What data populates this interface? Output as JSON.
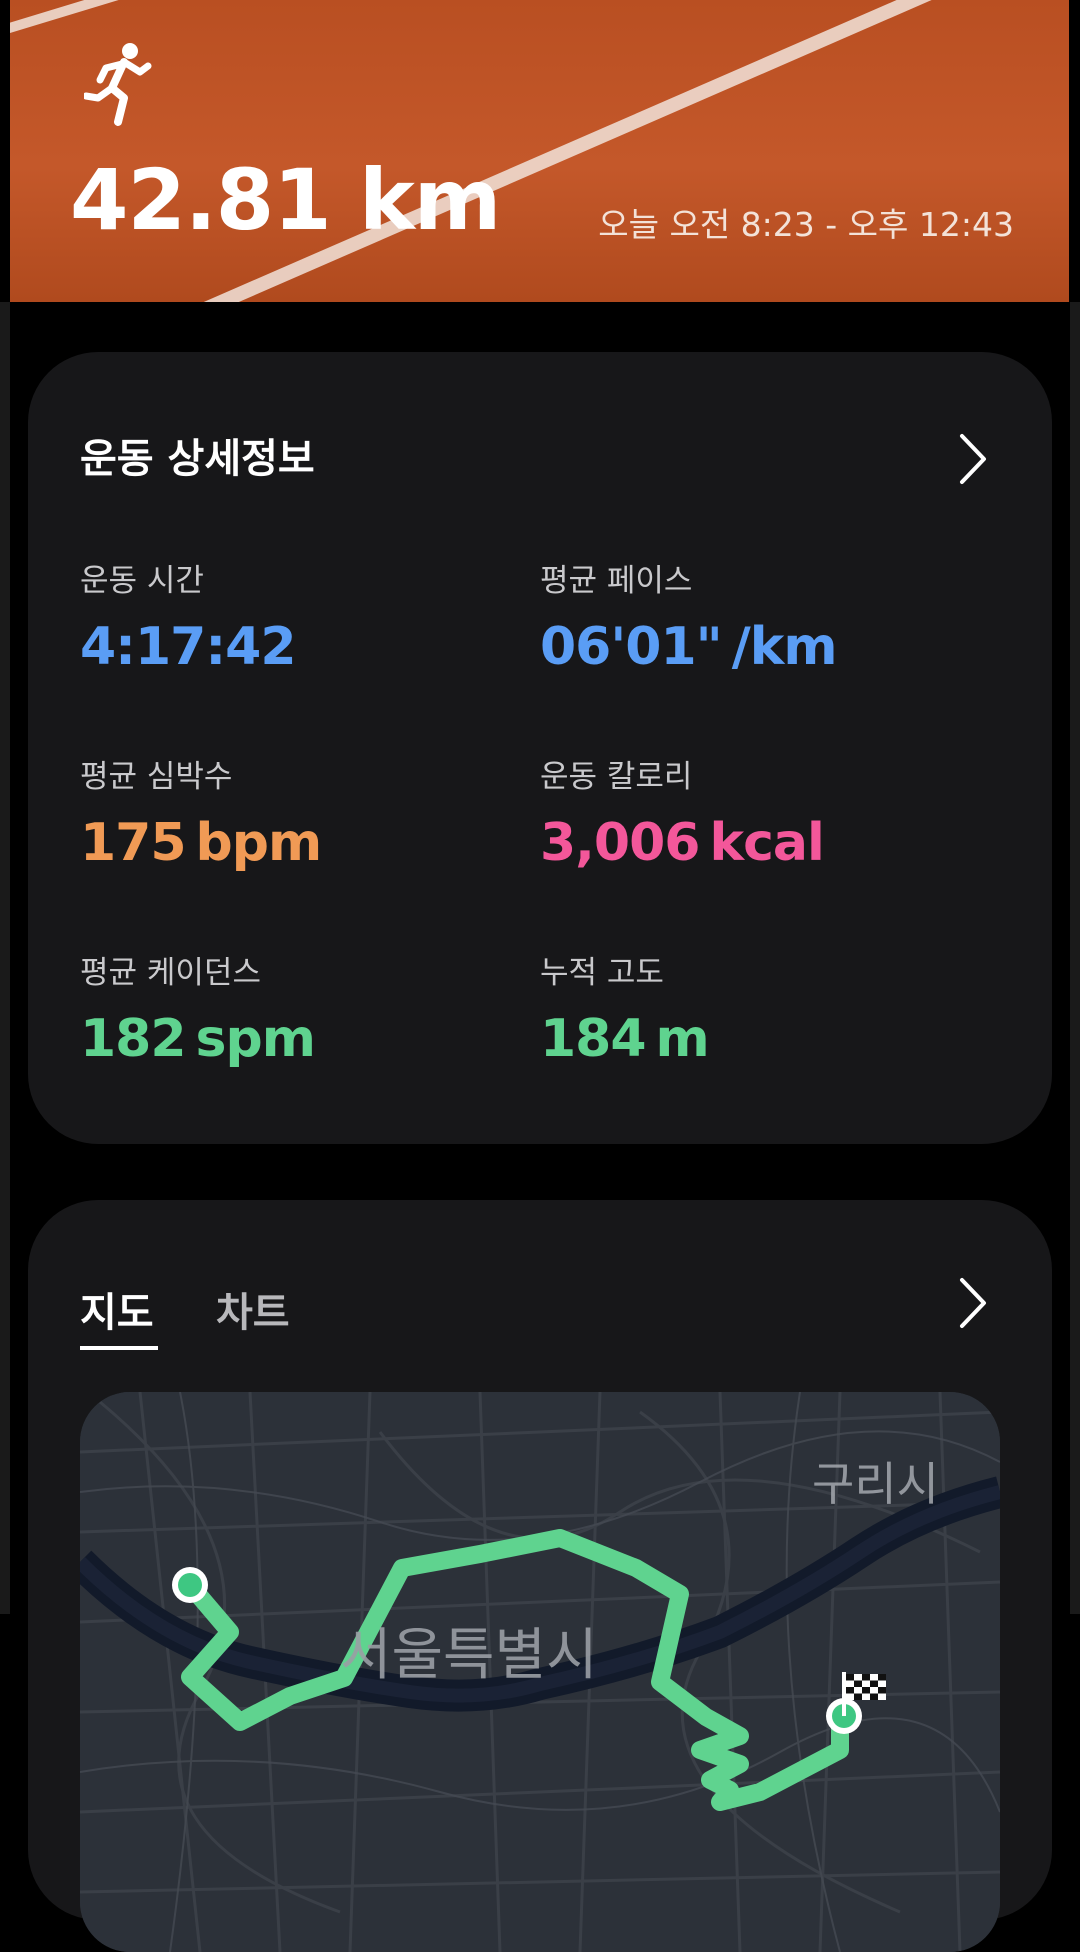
{
  "header": {
    "activity_icon": "running-person-icon",
    "distance": "42.81 km",
    "time_range": "오늘 오전 8:23 - 오후 12:43",
    "background_color": "#c4582a"
  },
  "details": {
    "title": "운동 상세정보",
    "chevron_icon": "chevron-right-icon",
    "metrics": [
      {
        "label": "운동 시간",
        "value": "4:17:42",
        "unit": "",
        "color": "#5a9df5"
      },
      {
        "label": "평균 페이스",
        "value": "06'01\"",
        "unit": "/km",
        "color": "#5a9df5"
      },
      {
        "label": "평균 심박수",
        "value": "175",
        "unit": "bpm",
        "color": "#f09a55"
      },
      {
        "label": "운동 칼로리",
        "value": "3,006",
        "unit": "kcal",
        "color": "#f3579a"
      },
      {
        "label": "평균 케이던스",
        "value": "182",
        "unit": "spm",
        "color": "#5fd38f"
      },
      {
        "label": "누적 고도",
        "value": "184",
        "unit": "m",
        "color": "#5fd38f"
      }
    ]
  },
  "map_card": {
    "tabs": [
      {
        "label": "지도",
        "selected": true
      },
      {
        "label": "차트",
        "selected": false
      }
    ],
    "chevron_icon": "chevron-right-icon",
    "map": {
      "labels": {
        "city": "서울특별시",
        "guri": "구리시"
      },
      "route_color": "#5fd38f",
      "start_icon": "start-marker-icon",
      "finish_icon": "checkered-flag-icon"
    }
  }
}
